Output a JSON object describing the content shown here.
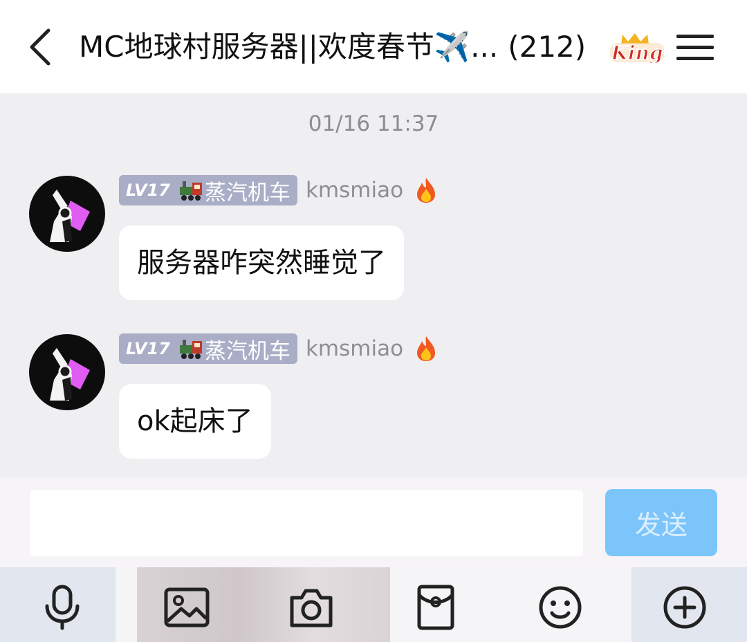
{
  "header": {
    "title": "MC地球村服务器||欢度春节✈️...",
    "member_count": "(212)",
    "badge_text": "King"
  },
  "chat": {
    "timestamp": "01/16 11:37",
    "messages": [
      {
        "level": "LV17",
        "title_tag": "蒸汽机车",
        "nickname": "kmsmiao",
        "text": "服务器咋突然睡觉了"
      },
      {
        "level": "LV17",
        "title_tag": "蒸汽机车",
        "nickname": "kmsmiao",
        "text": "ok起床了"
      }
    ]
  },
  "composer": {
    "input_value": "",
    "send_label": "发送"
  },
  "colors": {
    "header_bg": "#ffffff",
    "chat_bg": "#efeef1",
    "level_badge": "#a9adc6",
    "send_button": "#7cc5fb",
    "bubble_bg": "#ffffff"
  },
  "icons": {
    "header": [
      "back-arrow-icon",
      "king-badge-icon",
      "menu-icon"
    ],
    "toolbar": [
      "microphone-icon",
      "image-icon",
      "camera-icon",
      "red-packet-icon",
      "emoji-icon",
      "plus-icon"
    ]
  }
}
